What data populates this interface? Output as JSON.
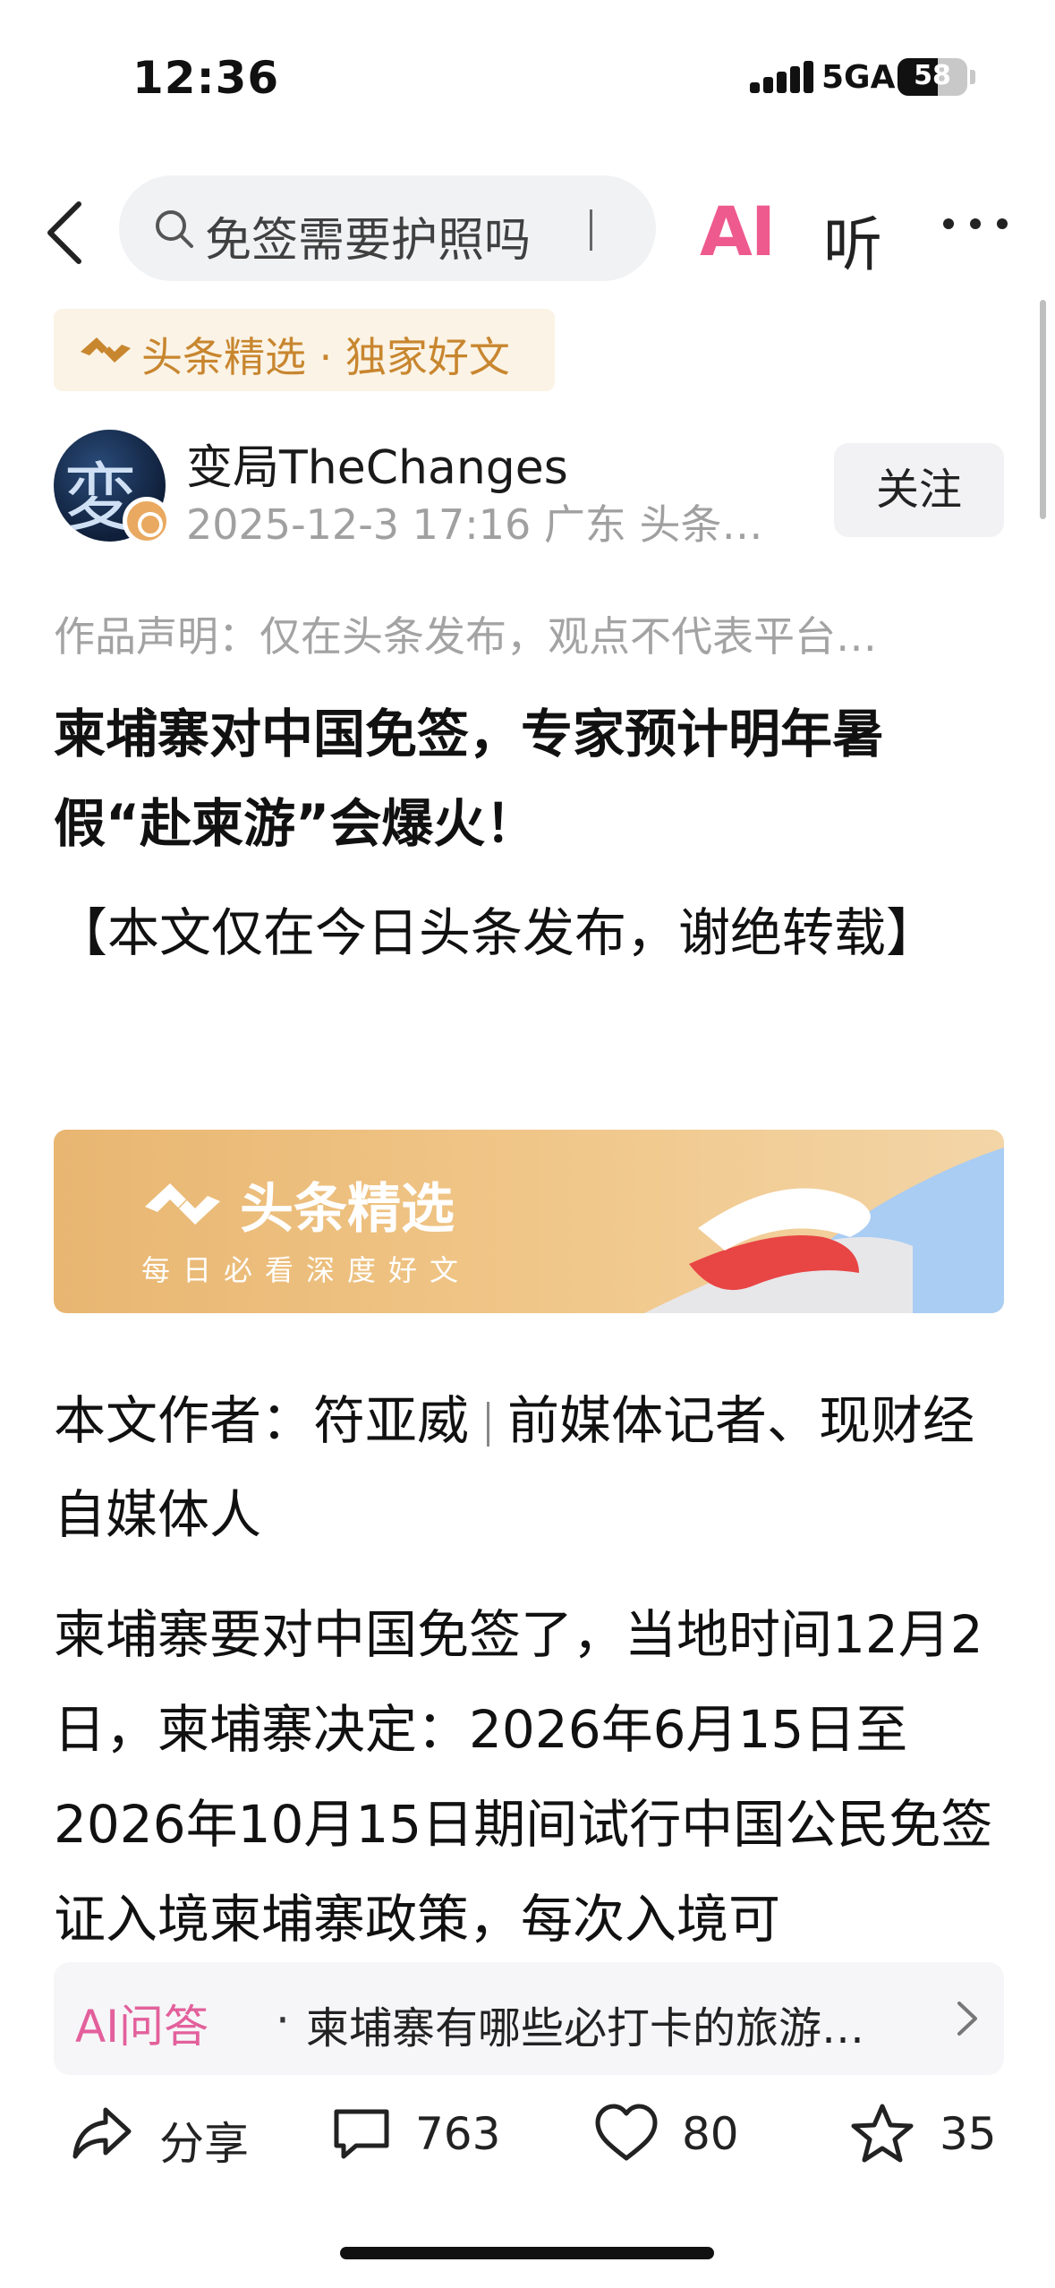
{
  "status_bar": {
    "time": "12:36",
    "network": "5GA",
    "battery": "58",
    "battery_level": 0.58
  },
  "nav": {
    "search_text": "免签需要护照吗",
    "ai_label": "AI",
    "listen_label": "听"
  },
  "badge": {
    "text": "头条精选 · 独家好文"
  },
  "author": {
    "avatar_glyph": "変",
    "name": "变局TheChanges",
    "meta": "2025-12-3 17:16 广东 头条…",
    "follow_label": "关注"
  },
  "statement": "作品声明：仅在头条发布，观点不代表平台…",
  "article": {
    "title": "柬埔寨对中国免签，专家预计明年暑假“赴柬游”会爆火！",
    "notice": "【本文仅在今日头条发布，谢绝转载】",
    "banner_title": "头条精选",
    "banner_subtitle": "每日必看深度好文",
    "author_line_a": "本文作者：符亚威",
    "author_line_b": "前媒体记者、现财经自媒体人",
    "body": "柬埔寨要对中国免签了，当地时间12月2日，柬埔寨决定：2026年6月15日至2026年10月15日期间试行中国公民免签证入境柬埔寨政策，每次入境可"
  },
  "ai_qa": {
    "label": "AI问答",
    "dot": "·",
    "question": "柬埔寨有哪些必打卡的旅游…"
  },
  "toolbar": {
    "share_label": "分享",
    "comment_count": "763",
    "like_count": "80",
    "favorite_count": "35"
  },
  "colors": {
    "accent_pink": "#ee5a8e",
    "badge_gold": "#c8862f",
    "banner_gold": "#e8b671"
  }
}
